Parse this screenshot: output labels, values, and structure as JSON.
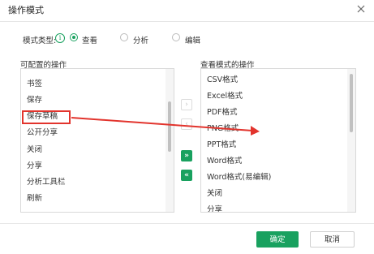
{
  "dialog": {
    "title": "操作模式"
  },
  "mode": {
    "label": "模式类型:",
    "options": [
      {
        "label": "查看",
        "selected": true
      },
      {
        "label": "分析",
        "selected": false
      },
      {
        "label": "编辑",
        "selected": false
      }
    ]
  },
  "left_panel": {
    "title": "可配置的操作",
    "items": [
      "书签",
      "保存",
      "保存草稿",
      "公开分享",
      "关闭",
      "分享",
      "分析工具栏",
      "刷新"
    ]
  },
  "right_panel": {
    "title": "查看模式的操作",
    "items": [
      "CSV格式",
      "Excel格式",
      "PDF格式",
      "PNG格式",
      "PPT格式",
      "Word格式",
      "Word格式(易编辑)",
      "关闭",
      "分享"
    ]
  },
  "transfer_buttons": {
    "add_one": "›",
    "remove_one": "‹",
    "add_all": "»",
    "remove_all": "«"
  },
  "footer": {
    "ok": "确定",
    "cancel": "取消"
  },
  "colors": {
    "accent": "#19a15f",
    "highlight": "#e2342d"
  },
  "icons": {
    "close": "close-icon",
    "info": "info-icon"
  }
}
